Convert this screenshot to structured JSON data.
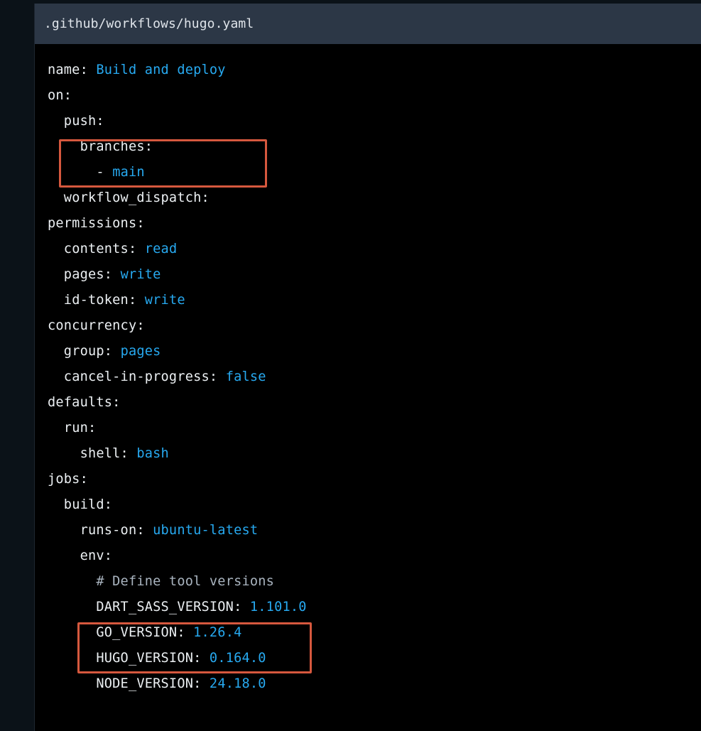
{
  "file": {
    "path": ".github/workflows/hugo.yaml"
  },
  "lines": [
    {
      "indent": "",
      "key": "name:",
      "value": "Build and deploy"
    },
    {
      "indent": "",
      "key": "on:",
      "value": ""
    },
    {
      "indent": "  ",
      "key": "push:",
      "value": ""
    },
    {
      "indent": "    ",
      "key": "branches:",
      "value": ""
    },
    {
      "indent": "      ",
      "key": "-",
      "value": "main"
    },
    {
      "indent": "  ",
      "key": "workflow_dispatch:",
      "value": ""
    },
    {
      "indent": "",
      "key": "permissions:",
      "value": ""
    },
    {
      "indent": "  ",
      "key": "contents:",
      "value": "read"
    },
    {
      "indent": "  ",
      "key": "pages:",
      "value": "write"
    },
    {
      "indent": "  ",
      "key": "id-token:",
      "value": "write"
    },
    {
      "indent": "",
      "key": "concurrency:",
      "value": ""
    },
    {
      "indent": "  ",
      "key": "group:",
      "value": "pages"
    },
    {
      "indent": "  ",
      "key": "cancel-in-progress:",
      "value": "false"
    },
    {
      "indent": "",
      "key": "defaults:",
      "value": ""
    },
    {
      "indent": "  ",
      "key": "run:",
      "value": ""
    },
    {
      "indent": "    ",
      "key": "shell:",
      "value": "bash"
    },
    {
      "indent": "",
      "key": "jobs:",
      "value": ""
    },
    {
      "indent": "  ",
      "key": "build:",
      "value": ""
    },
    {
      "indent": "    ",
      "key": "runs-on:",
      "value": "ubuntu-latest"
    },
    {
      "indent": "    ",
      "key": "env:",
      "value": ""
    },
    {
      "indent": "      ",
      "comment": "# Define tool versions"
    },
    {
      "indent": "      ",
      "key": "DART_SASS_VERSION:",
      "value": "1.101.0"
    },
    {
      "indent": "      ",
      "key": "GO_VERSION:",
      "value": "1.26.4"
    },
    {
      "indent": "      ",
      "key": "HUGO_VERSION:",
      "value": "0.164.0"
    },
    {
      "indent": "      ",
      "key": "NODE_VERSION:",
      "value": "24.18.0"
    }
  ],
  "colors": {
    "key": "#ecf0f3",
    "value": "#27a9f0",
    "comment": "#a9b4bf",
    "highlight": "#d6583e",
    "header_bg": "#2c3746"
  }
}
